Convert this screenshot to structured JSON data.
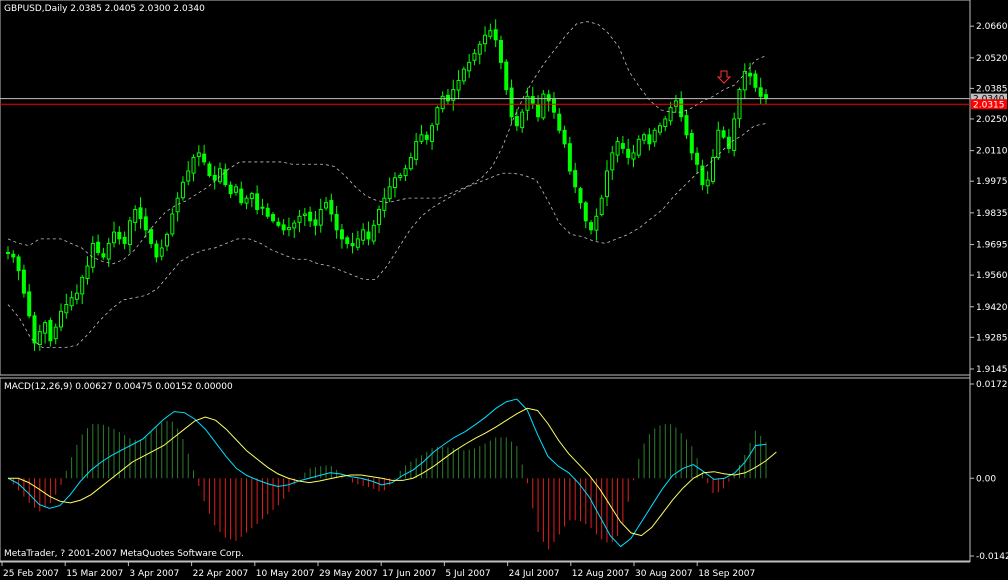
{
  "main_header": "GBPUSD,Daily  2.0385 2.0405 2.0300 2.0340",
  "indicator_header": "MACD(12,26,9) 0.00627 0.00475 0.00152 0.00000",
  "copyright": "MetaTrader, ? 2001-2007 MetaQuotes Software Corp.",
  "price_marker": "2.0340",
  "red_line_label": "2.0315",
  "colors": {
    "background": "#000000",
    "bull_candle": "#00ff00",
    "bear_candle": "#00ff00",
    "bands": "#c0c0c0",
    "macd_main": "#00e0ff",
    "macd_signal": "#ffff60",
    "hist_positive": "#2e7d2e",
    "hist_negative": "#e02020",
    "horizontal_line": "#ff0000",
    "current_price_line": "#c0c0c0",
    "arrow": "#ff3030"
  },
  "icons": {
    "arrow": "down-arrow-icon"
  },
  "chart_data": [
    {
      "type": "candlestick",
      "symbol": "GBPUSD",
      "timeframe": "Daily",
      "y_ticks": [
        "2.0660",
        "2.0520",
        "2.0385",
        "2.0250",
        "2.0110",
        "1.9975",
        "1.9835",
        "1.9695",
        "1.9560",
        "1.9420",
        "1.9285",
        "1.9145"
      ],
      "ylim": [
        1.9145,
        2.0705
      ],
      "x_ticks": [
        "25 Feb 2007",
        "15 Mar 2007",
        "3 Apr 2007",
        "22 Apr 2007",
        "10 May 2007",
        "29 May 2007",
        "17 Jun 2007",
        "5 Jul 2007",
        "24 Jul 2007",
        "12 Aug 2007",
        "30 Aug 2007",
        "18 Sep 2007"
      ],
      "close_path": [
        1.966,
        1.964,
        1.958,
        1.948,
        1.938,
        1.926,
        1.931,
        1.935,
        1.927,
        1.933,
        1.94,
        1.943,
        1.946,
        1.948,
        1.955,
        1.96,
        1.97,
        1.966,
        1.964,
        1.97,
        1.975,
        1.972,
        1.97,
        1.98,
        1.985,
        1.981,
        1.976,
        1.97,
        1.964,
        1.968,
        1.974,
        1.983,
        1.99,
        1.997,
        2.002,
        2.008,
        2.01,
        2.006,
        2.0,
        1.998,
        2.003,
        1.996,
        1.992,
        1.995,
        1.988,
        1.99,
        1.992,
        1.985,
        1.986,
        1.982,
        1.98,
        1.978,
        1.976,
        1.977,
        1.979,
        1.982,
        1.983,
        1.98,
        1.978,
        1.985,
        1.988,
        1.983,
        1.976,
        1.972,
        1.97,
        1.969,
        1.972,
        1.976,
        1.972,
        1.978,
        1.985,
        1.99,
        1.995,
        1.999,
        2.0,
        2.003,
        2.008,
        2.015,
        2.018,
        2.016,
        2.022,
        2.03,
        2.035,
        2.033,
        2.038,
        2.042,
        2.047,
        2.05,
        2.054,
        2.058,
        2.062,
        2.064,
        2.06,
        2.05,
        2.038,
        2.026,
        2.022,
        2.028,
        2.035,
        2.032,
        2.026,
        2.036,
        2.033,
        2.028,
        2.02,
        2.014,
        2.002,
        1.995,
        1.988,
        1.98,
        1.976,
        1.982,
        1.99,
        2.002,
        2.01,
        2.015,
        2.012,
        2.008,
        2.01,
        2.016,
        2.018,
        2.014,
        2.02,
        2.022,
        2.025,
        2.03,
        2.033,
        2.026,
        2.018,
        2.01,
        2.005,
        1.996,
        1.998,
        2.008,
        2.02,
        2.017,
        2.012,
        2.025,
        2.038,
        2.046,
        2.044,
        2.039,
        2.035,
        2.034
      ],
      "upper_band": [
        1.972,
        1.97,
        1.969,
        1.972,
        1.972,
        1.972,
        1.97,
        1.968,
        1.964,
        1.962,
        1.961,
        1.963,
        1.967,
        1.973,
        1.979,
        1.984,
        1.987,
        1.989,
        1.992,
        1.995,
        1.999,
        2.003,
        2.006,
        2.006,
        2.006,
        2.006,
        2.006,
        2.005,
        2.005,
        2.005,
        2.005,
        2.004,
        2.0,
        1.995,
        1.991,
        1.989,
        1.988,
        1.989,
        1.99,
        1.99,
        1.99,
        1.99,
        1.992,
        1.994,
        1.996,
        1.999,
        2.004,
        2.013,
        2.025,
        2.035,
        2.043,
        2.05,
        2.056,
        2.062,
        2.067,
        2.068,
        2.067,
        2.063,
        2.057,
        2.046,
        2.039,
        2.033,
        2.029,
        2.028,
        2.028,
        2.03,
        2.033,
        2.035,
        2.038,
        2.04,
        2.045,
        2.051,
        2.053
      ],
      "lower_band": [
        1.943,
        1.937,
        1.928,
        1.924,
        1.924,
        1.924,
        1.925,
        1.93,
        1.936,
        1.941,
        1.945,
        1.946,
        1.947,
        1.95,
        1.956,
        1.962,
        1.965,
        1.967,
        1.968,
        1.97,
        1.972,
        1.972,
        1.97,
        1.967,
        1.965,
        1.963,
        1.963,
        1.961,
        1.96,
        1.958,
        1.956,
        1.954,
        1.954,
        1.96,
        1.968,
        1.976,
        1.982,
        1.986,
        1.989,
        1.992,
        1.995,
        1.997,
        1.999,
        2.001,
        2.001,
        2.0,
        1.998,
        1.989,
        1.979,
        1.974,
        1.973,
        1.971,
        1.97,
        1.972,
        1.974,
        1.977,
        1.981,
        1.985,
        1.991,
        1.996,
        2.001,
        2.005,
        2.01,
        2.015,
        2.018,
        2.022,
        2.023
      ]
    },
    {
      "type": "macd",
      "name": "MACD(12,26,9)",
      "y_ticks": [
        "0.01725",
        "0.00",
        "-0.01423"
      ],
      "ylim": [
        -0.01423,
        0.01725
      ],
      "macd": [
        0.0,
        -0.001,
        -0.0028,
        -0.0048,
        -0.0055,
        -0.005,
        -0.003,
        -0.0005,
        0.0015,
        0.003,
        0.0042,
        0.0052,
        0.0062,
        0.0072,
        0.009,
        0.0108,
        0.0122,
        0.012,
        0.0108,
        0.009,
        0.0065,
        0.004,
        0.0018,
        0.0005,
        -0.0003,
        -0.001,
        -0.0015,
        -0.0012,
        -0.0005,
        0.0,
        0.0005,
        0.001,
        0.0008,
        0.0003,
        0.0,
        -0.0005,
        -0.0012,
        -0.0008,
        0.0005,
        0.0015,
        0.003,
        0.0048,
        0.0062,
        0.0075,
        0.0085,
        0.0098,
        0.0112,
        0.0128,
        0.014,
        0.0145,
        0.0125,
        0.008,
        0.004,
        0.0022,
        0.001,
        -0.001,
        -0.0035,
        -0.007,
        -0.0105,
        -0.0125,
        -0.011,
        -0.008,
        -0.005,
        -0.002,
        0.0005,
        0.0018,
        0.0025,
        0.0012,
        -0.0002,
        0.0,
        0.001,
        0.003,
        0.006,
        0.0062
      ],
      "signal": [
        0.0,
        0.0,
        -0.0008,
        -0.002,
        -0.0033,
        -0.0042,
        -0.0045,
        -0.004,
        -0.003,
        -0.0015,
        0.0,
        0.0015,
        0.003,
        0.004,
        0.005,
        0.006,
        0.0075,
        0.009,
        0.0105,
        0.0112,
        0.0106,
        0.009,
        0.007,
        0.005,
        0.0035,
        0.002,
        0.0008,
        0.0,
        -0.0005,
        -0.0008,
        -0.0005,
        -0.0001,
        0.0003,
        0.0006,
        0.0006,
        0.0003,
        0.0,
        -0.0004,
        -0.0004,
        0.0,
        0.001,
        0.0022,
        0.0036,
        0.005,
        0.0062,
        0.0073,
        0.0083,
        0.0094,
        0.0106,
        0.0118,
        0.0128,
        0.0124,
        0.01,
        0.007,
        0.0045,
        0.0025,
        0.0005,
        -0.002,
        -0.005,
        -0.008,
        -0.01,
        -0.0105,
        -0.009,
        -0.0065,
        -0.004,
        -0.0018,
        0.0,
        0.001,
        0.0012,
        0.0008,
        0.0006,
        0.001,
        0.002,
        0.0032,
        0.0048
      ],
      "histogram_note": "derived: macd - signal"
    }
  ]
}
